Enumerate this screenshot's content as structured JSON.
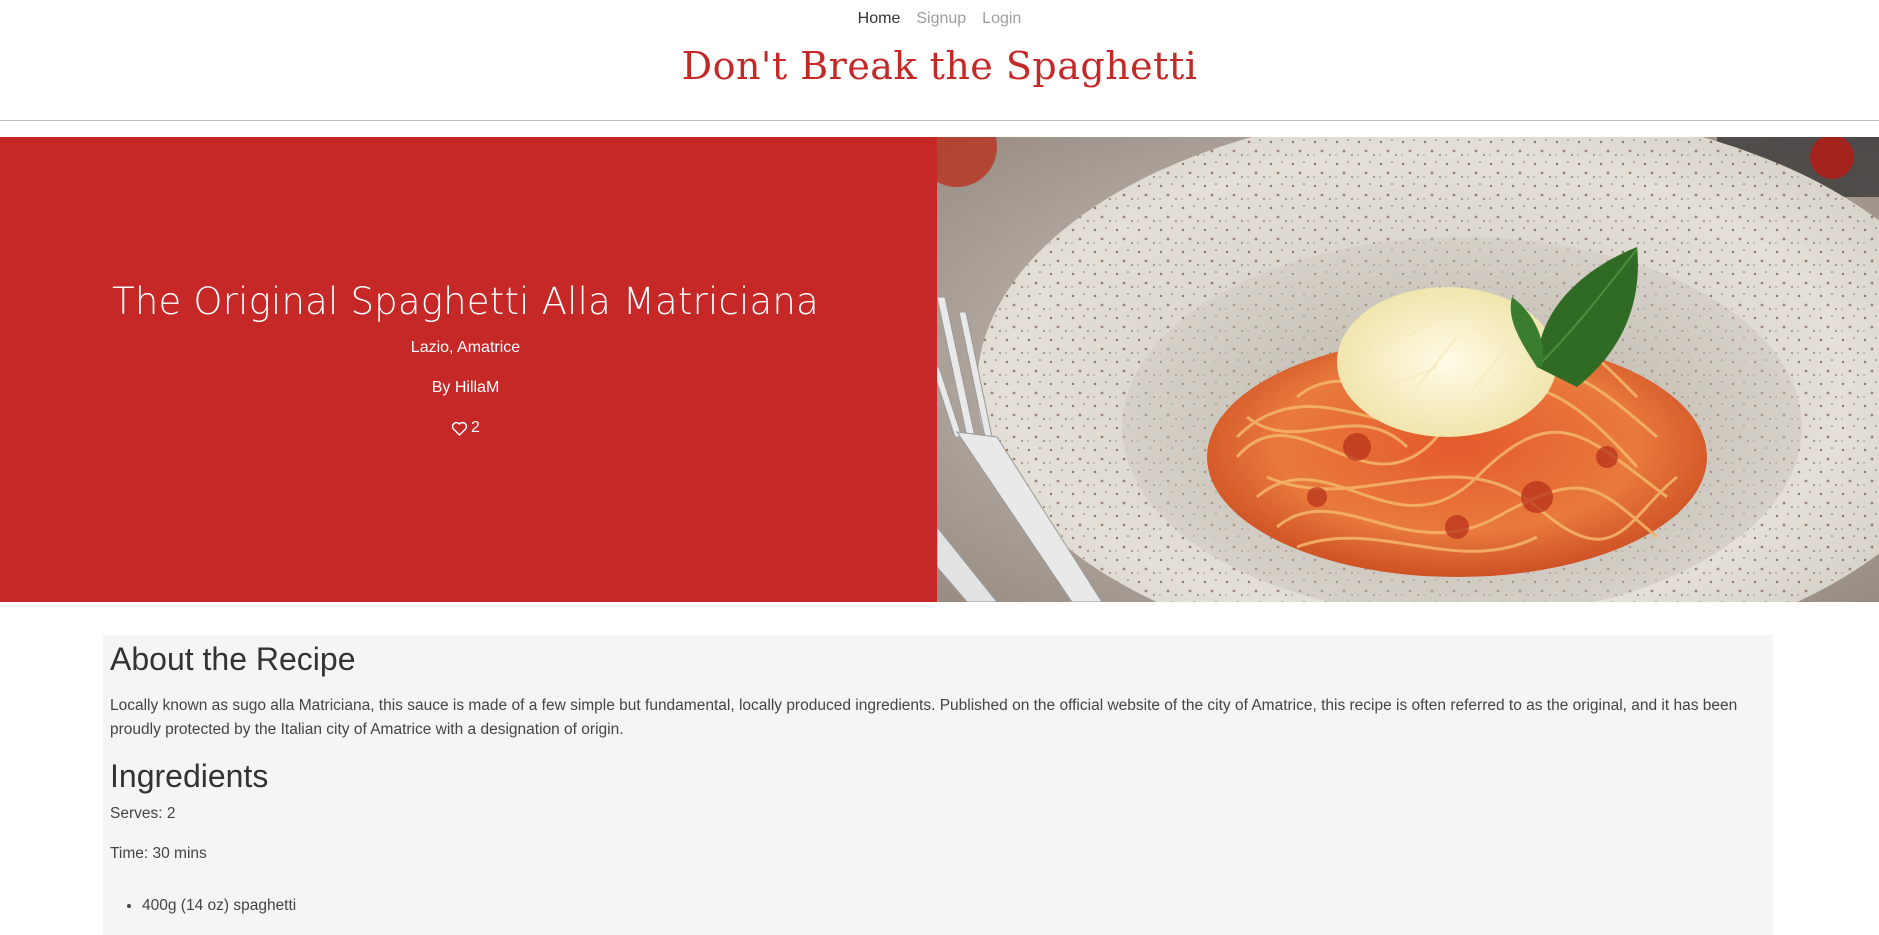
{
  "nav": {
    "home": "Home",
    "signup": "Signup",
    "login": "Login"
  },
  "site": {
    "title": "Don't Break the Spaghetti"
  },
  "recipe": {
    "title": "The Original Spaghetti Alla Matriciana",
    "region": "Lazio, Amatrice",
    "author": "By HillaM",
    "likes": "2",
    "image_alt": "spaghetti alla matriciana in a speckled ceramic bowl with grated cheese and basil"
  },
  "about": {
    "heading": "About the Recipe",
    "text": "Locally known as sugo alla Matriciana, this sauce is made of a few simple but fundamental, locally produced ingredients. Published on the official website of the city of Amatrice, this recipe is often referred to as the original, and it has been proudly protected by the Italian city of Amatrice with a designation of origin."
  },
  "ingredients": {
    "heading": "Ingredients",
    "serves": "Serves: 2",
    "time": "Time: 30 mins",
    "items": [
      "400g (14 oz) spaghetti"
    ]
  },
  "colors": {
    "brand_red": "#c62828",
    "content_bg": "#f5f5f5"
  },
  "icons": {
    "likes": "heart-outline-icon"
  }
}
